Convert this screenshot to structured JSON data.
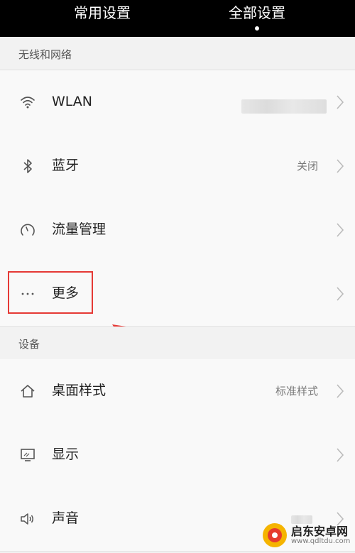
{
  "tabs": {
    "common_label": "常用设置",
    "all_label": "全部设置"
  },
  "sections": {
    "wireless": "无线和网络",
    "device": "设备"
  },
  "rows": {
    "wlan": {
      "label": "WLAN",
      "value": ""
    },
    "bluetooth": {
      "label": "蓝牙",
      "value": "关闭"
    },
    "data_usage": {
      "label": "流量管理",
      "value": ""
    },
    "more": {
      "label": "更多",
      "value": ""
    },
    "desktop_style": {
      "label": "桌面样式",
      "value": "标准样式"
    },
    "display": {
      "label": "显示",
      "value": ""
    },
    "sound": {
      "label": "声音",
      "value": ""
    }
  },
  "watermark": {
    "title": "启东安卓网",
    "url": "www.qdltdu.com"
  },
  "colors": {
    "topbar": "#000000",
    "background": "#f2f2f2",
    "row": "#f9f9f9",
    "highlight": "#e53935"
  }
}
